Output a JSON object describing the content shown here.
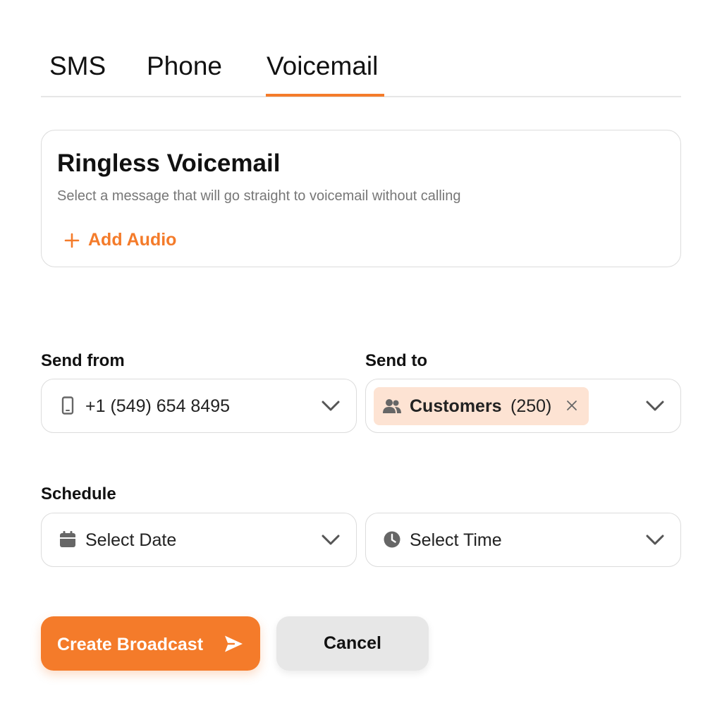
{
  "tabs": [
    {
      "label": "SMS"
    },
    {
      "label": "Phone"
    },
    {
      "label": "Voicemail",
      "active": true
    }
  ],
  "card": {
    "title": "Ringless Voicemail",
    "subtitle": "Select a message that will go straight to voicemail without calling",
    "add_audio_label": "Add Audio",
    "add_audio_icon": "plus-icon"
  },
  "send_from": {
    "label": "Send from",
    "value": "+1 (549) 654 8495",
    "icon": "phone-icon"
  },
  "send_to": {
    "label": "Send to",
    "chip_name": "Customers",
    "chip_count": "(250)",
    "chip_icon": "users-icon"
  },
  "schedule": {
    "label": "Schedule",
    "date_placeholder": "Select Date",
    "date_icon": "calendar-icon",
    "time_placeholder": "Select Time",
    "time_icon": "clock-icon"
  },
  "actions": {
    "create_label": "Create Broadcast",
    "create_icon": "send-icon",
    "cancel_label": "Cancel"
  },
  "colors": {
    "accent": "#f47b2a",
    "chip_bg": "#fde3d3",
    "border": "#dcdcdc",
    "muted_text": "#777777",
    "secondary_button": "#e7e7e7"
  }
}
